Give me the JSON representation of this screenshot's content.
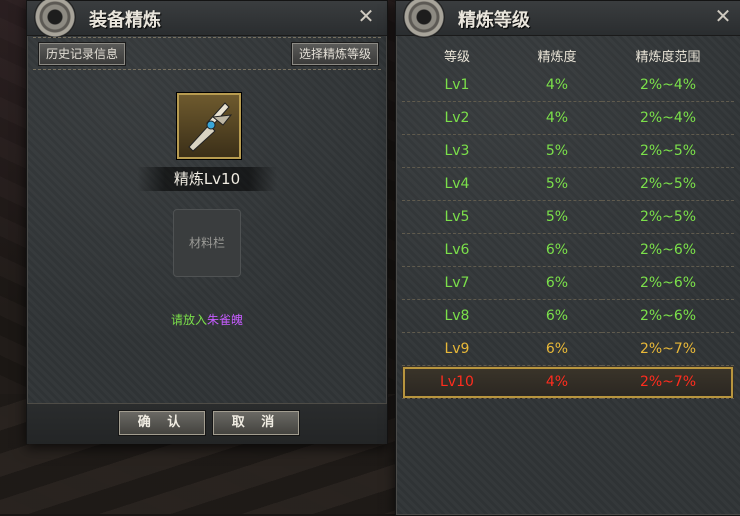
{
  "left_panel": {
    "title": "装备精炼",
    "history_button": "历史记录信息",
    "select_level_button": "选择精炼等级",
    "item_name": "精炼Lv10",
    "material_slot_label": "材料栏",
    "hint_prefix": "请放入",
    "hint_material": "朱雀魄",
    "confirm_button": "确 认",
    "cancel_button": "取 消"
  },
  "right_panel": {
    "title": "精炼等级",
    "headers": [
      "等级",
      "精炼度",
      "精炼度范围"
    ],
    "rows": [
      {
        "level": "Lv1",
        "degree": "4%",
        "range": "2%~4%",
        "tier": "green"
      },
      {
        "level": "Lv2",
        "degree": "4%",
        "range": "2%~4%",
        "tier": "green"
      },
      {
        "level": "Lv3",
        "degree": "5%",
        "range": "2%~5%",
        "tier": "green"
      },
      {
        "level": "Lv4",
        "degree": "5%",
        "range": "2%~5%",
        "tier": "green"
      },
      {
        "level": "Lv5",
        "degree": "5%",
        "range": "2%~5%",
        "tier": "green"
      },
      {
        "level": "Lv6",
        "degree": "6%",
        "range": "2%~6%",
        "tier": "green"
      },
      {
        "level": "Lv7",
        "degree": "6%",
        "range": "2%~6%",
        "tier": "green"
      },
      {
        "level": "Lv8",
        "degree": "6%",
        "range": "2%~6%",
        "tier": "green"
      },
      {
        "level": "Lv9",
        "degree": "6%",
        "range": "2%~7%",
        "tier": "yellow"
      },
      {
        "level": "Lv10",
        "degree": "4%",
        "range": "2%~7%",
        "tier": "red",
        "selected": true
      }
    ]
  },
  "colors": {
    "green": "#7be04a",
    "yellow": "#e8b838",
    "red": "#ff2c1e",
    "purple": "#c65cff"
  },
  "icons": [
    "gear-icon",
    "close-icon",
    "weapon-item-icon"
  ]
}
